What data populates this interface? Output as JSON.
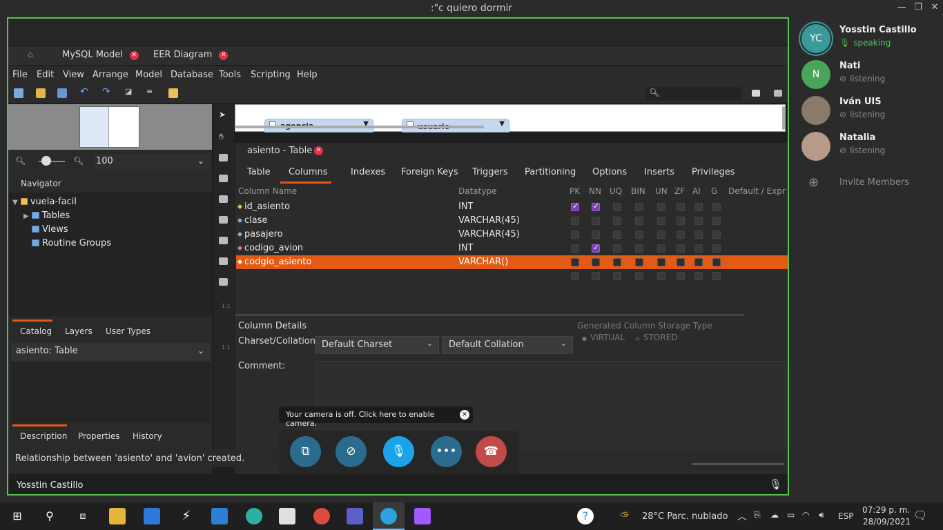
{
  "window": {
    "title": ":\"c quiero dormir"
  },
  "workbench": {
    "tabs": [
      {
        "label": "MySQL Model"
      },
      {
        "label": "EER Diagram"
      }
    ],
    "menu": [
      "File",
      "Edit",
      "View",
      "Arrange",
      "Model",
      "Database",
      "Tools",
      "Scripting",
      "Help"
    ],
    "zoom": "100",
    "navigator_label": "Navigator",
    "tree": {
      "schema": "vuela-facil",
      "items": [
        "Tables",
        "Views",
        "Routine Groups"
      ]
    },
    "left_tabs": [
      "Catalog",
      "Layers",
      "User Types"
    ],
    "object_select": "asiento: Table",
    "bottom_tabs": [
      "Description",
      "Properties",
      "History"
    ],
    "status": "Relationship between 'asiento' and 'avion' created.",
    "diagram_entities": [
      "agencia",
      "usuario"
    ]
  },
  "table_editor": {
    "title": "asiento - Table",
    "subtabs": [
      "Table",
      "Columns",
      "Indexes",
      "Foreign Keys",
      "Triggers",
      "Partitioning",
      "Options",
      "Inserts",
      "Privileges"
    ],
    "headers": [
      "Column Name",
      "Datatype",
      "PK",
      "NN",
      "UQ",
      "BIN",
      "UN",
      "ZF",
      "AI",
      "G",
      "Default / Expr"
    ],
    "rows": [
      {
        "name": "id_asiento",
        "type": "INT",
        "pk": true,
        "nn": true
      },
      {
        "name": "clase",
        "type": "VARCHAR(45)",
        "pk": false,
        "nn": false
      },
      {
        "name": "pasajero",
        "type": "VARCHAR(45)",
        "pk": false,
        "nn": false
      },
      {
        "name": "codigo_avion",
        "type": "INT",
        "pk": false,
        "nn": true
      },
      {
        "name": "codgio_asiento",
        "type": "VARCHAR()",
        "pk": false,
        "nn": false,
        "selected": true
      }
    ],
    "details": {
      "title": "Column Details",
      "charset_label": "Charset/Collation:",
      "charset": "Default Charset",
      "collation": "Default Collation",
      "storage_title": "Generated Column Storage Type",
      "virtual": "VIRTUAL",
      "stored": "STORED",
      "comment_label": "Comment:"
    }
  },
  "call": {
    "tooltip": "Your camera is off. Click here to enable camera.",
    "speaker_name": "Yosstin Castillo",
    "colors": {
      "share": "#2a6b8e",
      "mic_active": "#1aa3e8",
      "hangup": "#c14b48"
    }
  },
  "members": [
    {
      "initials": "YC",
      "name": "Yosstin Castillo",
      "status": "speaking",
      "color": "#3a9a9a"
    },
    {
      "initials": "N",
      "name": "Nati",
      "status": "listening",
      "color": "#4aa55a"
    },
    {
      "initials": "",
      "name": "Iván UIS",
      "status": "listening",
      "color": "#8a7a6a"
    },
    {
      "initials": "",
      "name": "Natalia",
      "status": "listening",
      "color": "#b89a8a"
    }
  ],
  "invite_label": "Invite Members",
  "taskbar": {
    "weather": "28°C  Parc. nublado",
    "lang": "ESP",
    "time": "07:29 p. m.",
    "date": "28/09/2021"
  }
}
